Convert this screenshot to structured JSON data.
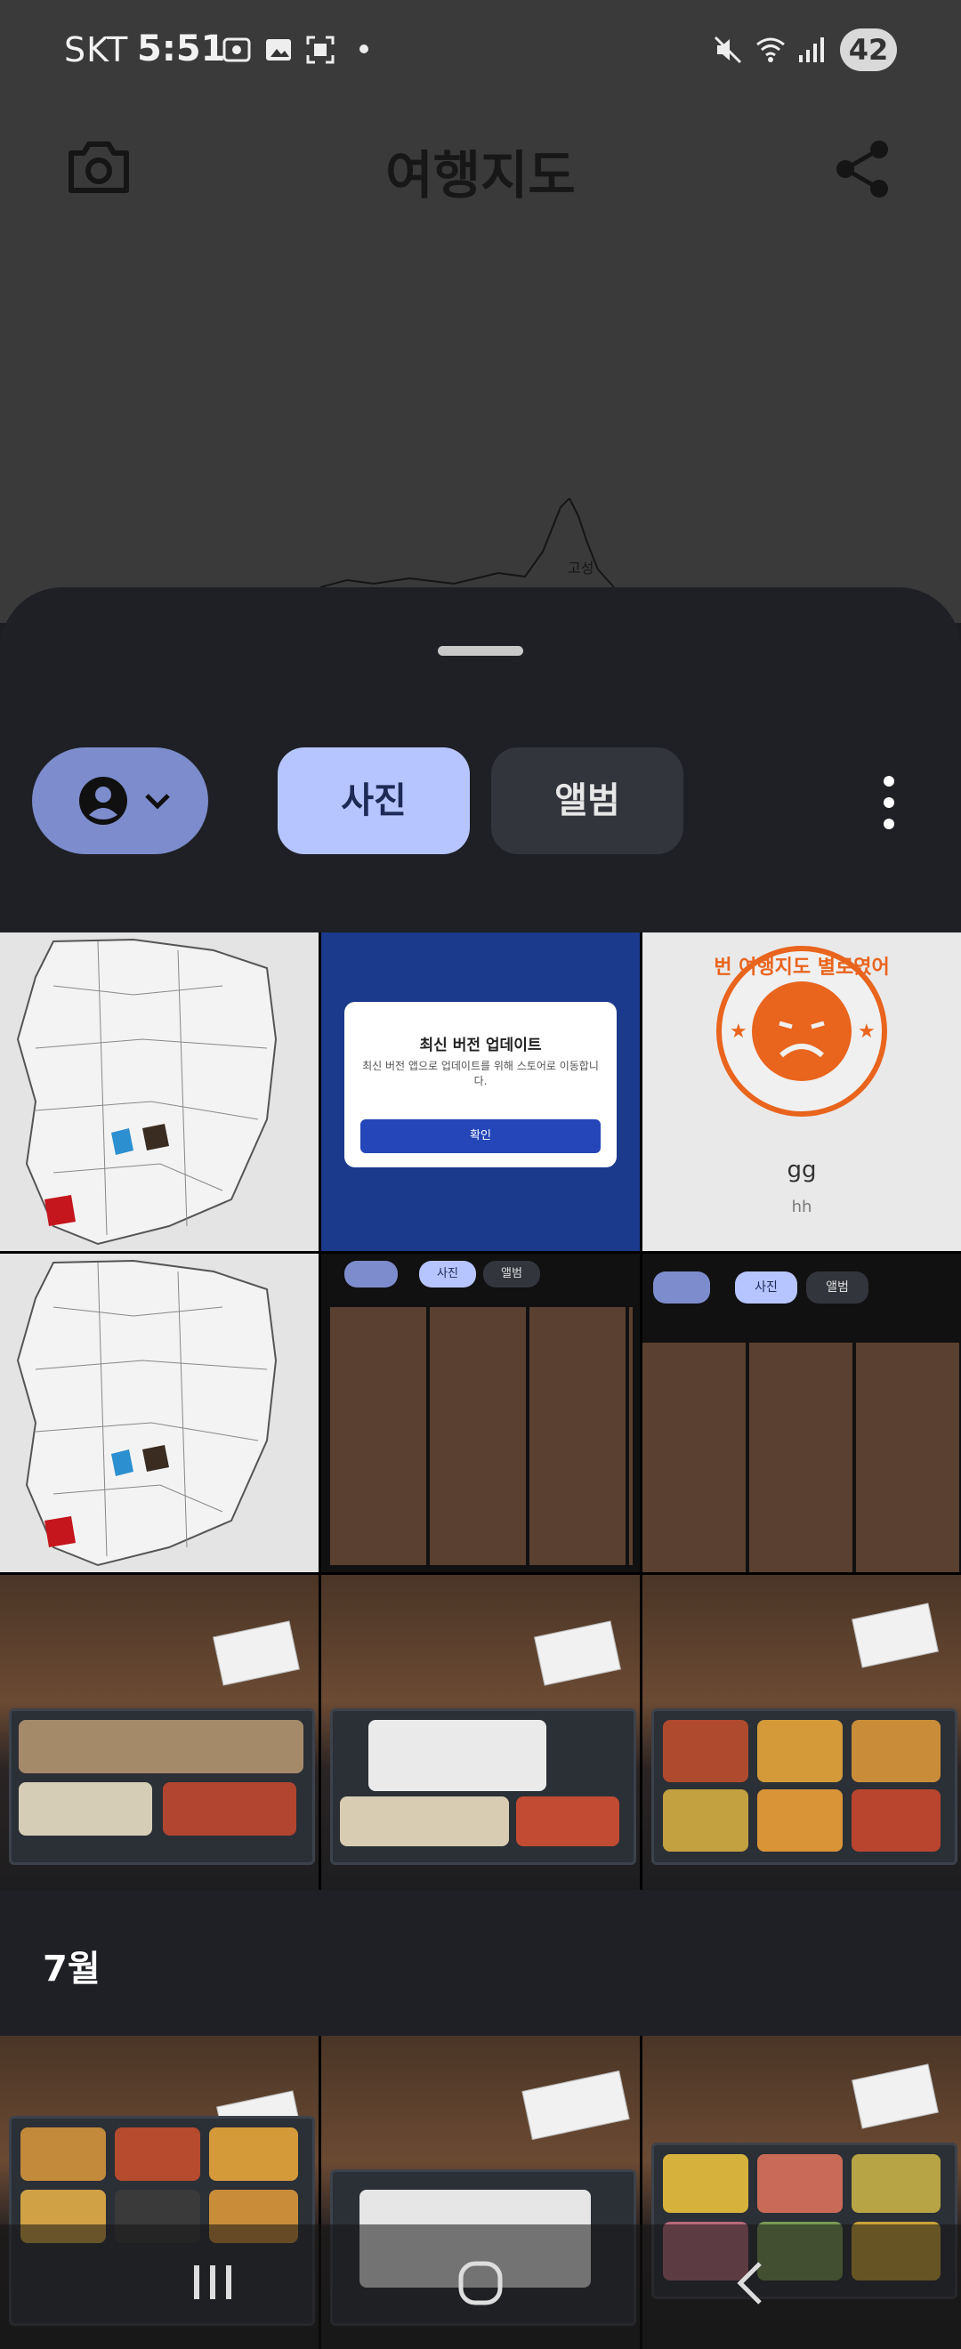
{
  "status_bar": {
    "carrier": "SKT",
    "time": "5:51",
    "battery": "42"
  },
  "app_bar": {
    "title": "여행지도",
    "left_icon": "camera-icon",
    "right_icon": "share-icon"
  },
  "map_label": "고성",
  "sheet": {
    "tabs": [
      {
        "label": "사진",
        "selected": true
      },
      {
        "label": "앨범",
        "selected": false
      }
    ],
    "user_chip_icons": [
      "account-circle-icon",
      "chevron-down-icon"
    ],
    "more_icon": "more-vert-icon"
  },
  "tiles": {
    "update_dialog": {
      "title": "최신 버전 업데이트",
      "body": "최신 버전 앱으로 업데이트를 위해 스토어로 이동합니다.",
      "button": "확인"
    },
    "stamp": {
      "ring_text": "이번 여행지도 별로였어요",
      "caption": "gg",
      "subcaption": "hh"
    },
    "mini_tabs": {
      "photo": "사진",
      "album": "앨범"
    }
  },
  "section": {
    "month": "7월"
  },
  "nav": {
    "recents": "recents-icon",
    "home": "home-icon",
    "back": "back-icon"
  },
  "colors": {
    "sheet_bg": "#1f2025",
    "tab_selected": "#b6c5ff",
    "tab_unselected": "#33353c",
    "chip": "#7c8ccc",
    "dialog_blue": "#1c3a8c"
  }
}
